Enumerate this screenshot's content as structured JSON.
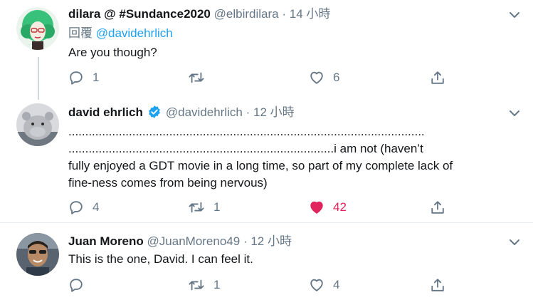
{
  "tweets": [
    {
      "name": "dilara @ #Sundance2020",
      "handle": "@elbirdilara",
      "separator": "·",
      "time": "14 小時",
      "reply_prefix": "回覆",
      "reply_to": "@davidehrlich",
      "text": [
        "Are you though?"
      ],
      "reply_count": "1",
      "retweet_count": "",
      "like_count": "6",
      "liked": false
    },
    {
      "name": "david ehrlich",
      "verified": true,
      "handle": "@davidehrlich",
      "separator": "·",
      "time": "12 小時",
      "text": [
        "..........................................................................................................",
        "...............................................................................i am not (haven’t",
        "fully enjoyed a GDT movie in a long time, so part of my complete lack of",
        "fine-ness comes from being nervous)"
      ],
      "reply_count": "4",
      "retweet_count": "1",
      "like_count": "42",
      "liked": true
    },
    {
      "name": "Juan Moreno",
      "handle": "@JuanMoreno49",
      "separator": "·",
      "time": "12 小時",
      "text": [
        "This is the one, David. I can feel it."
      ],
      "reply_count": "",
      "retweet_count": "1",
      "like_count": "4",
      "liked": false
    }
  ],
  "colors": {
    "accent": "#1da1f2",
    "like_active": "#e0245e",
    "muted": "#657786",
    "divider": "#e6ecf0"
  },
  "icons": [
    "reply-icon",
    "retweet-icon",
    "like-icon",
    "share-icon",
    "chevron-down-icon",
    "verified-badge-icon"
  ]
}
